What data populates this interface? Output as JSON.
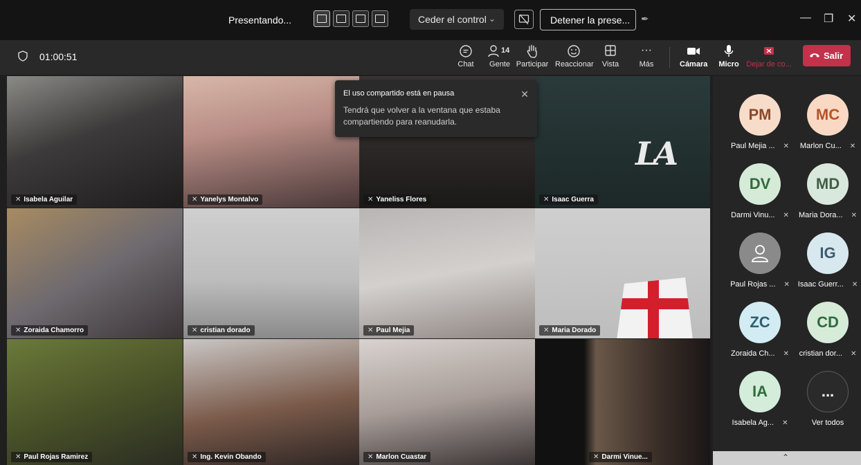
{
  "sharing_bar": {
    "presenting_label": "Presentando...",
    "control_dropdown": "Ceder el control",
    "stop_presenting": "Detener la prese..."
  },
  "meeting": {
    "timer": "01:00:51",
    "toolbar": {
      "chat": "Chat",
      "people": "Gente",
      "people_count": "14",
      "raise_hand": "Participar",
      "react": "Reaccionar",
      "view": "Vista",
      "more": "Más",
      "camera": "Cámara",
      "mic": "Micro",
      "stop_share": "Dejar de co...",
      "leave": "Salir"
    }
  },
  "notification": {
    "title": "El uso compartido está en pausa",
    "body": "Tendrá que volver a la ventana que estaba compartiendo para reanudarla."
  },
  "video_tiles": [
    {
      "name": "Isabela Aguilar"
    },
    {
      "name": "Yanelys Montalvo"
    },
    {
      "name": "Yaneliss Flores"
    },
    {
      "name": "Isaac Guerra"
    },
    {
      "name": "Zoraida Chamorro"
    },
    {
      "name": "cristian dorado"
    },
    {
      "name": "Paul Mejia"
    },
    {
      "name": "Maria Dorado"
    },
    {
      "name": "Paul Rojas Ramirez"
    },
    {
      "name": "Ing. Kevin Obando"
    },
    {
      "name": "Marlon Cuastar"
    },
    {
      "name": "Darmi Vinue..."
    }
  ],
  "roster": [
    {
      "initials": "PM",
      "name": "Paul Mejia ...",
      "color": "#f7dcc9",
      "text_color": "#8a4a2a"
    },
    {
      "initials": "MC",
      "name": "Marlon Cu...",
      "color": "#f9d9c3",
      "text_color": "#b5532a"
    },
    {
      "initials": "DV",
      "name": "Darmi Vinu...",
      "color": "#d6ead8",
      "text_color": "#2f6b3c"
    },
    {
      "initials": "MD",
      "name": "Maria Dora...",
      "color": "#d9e8dc",
      "text_color": "#3f5f47"
    },
    {
      "initials": "",
      "name": "Paul Rojas ...",
      "color": "#8a8a8a",
      "text_color": "#ffffff"
    },
    {
      "initials": "IG",
      "name": "Isaac Guerr...",
      "color": "#d8e8ef",
      "text_color": "#3e5d6e"
    },
    {
      "initials": "ZC",
      "name": "Zoraida Ch...",
      "color": "#d3ecf3",
      "text_color": "#2f5f72"
    },
    {
      "initials": "CD",
      "name": "cristian dor...",
      "color": "#d6ecd9",
      "text_color": "#2f6b3c"
    },
    {
      "initials": "IA",
      "name": "Isabela Ag...",
      "color": "#d4ecda",
      "text_color": "#2f6b3c"
    },
    {
      "initials": "...",
      "name": "Ver todos",
      "color": "#2a2a2a",
      "text_color": "#ffffff"
    }
  ]
}
